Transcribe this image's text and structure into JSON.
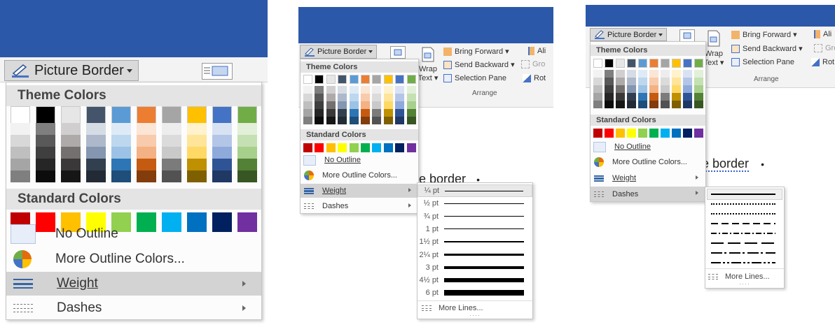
{
  "colors": {
    "titlebar": "#2b58a8",
    "theme_colors": [
      "#ffffff",
      "#000000",
      "#e7e6e6",
      "#44546a",
      "#5b9bd5",
      "#ed7d31",
      "#a5a5a5",
      "#ffc000",
      "#4472c4",
      "#70ad47"
    ],
    "theme_shades": [
      [
        "#f2f2f2",
        "#7f7f7f",
        "#d0cece",
        "#d6dce4",
        "#deebf6",
        "#fbe5d5",
        "#ededed",
        "#fff2cc",
        "#d9e2f3",
        "#e2efd9"
      ],
      [
        "#d8d8d8",
        "#595959",
        "#aeaaaa",
        "#adb9ca",
        "#bdd7ee",
        "#f7cbac",
        "#dbdbdb",
        "#fee599",
        "#b4c6e7",
        "#c5e0b3"
      ],
      [
        "#bfbfbf",
        "#3f3f3f",
        "#757070",
        "#8496b0",
        "#9cc3e5",
        "#f4b183",
        "#c9c9c9",
        "#ffd965",
        "#8eaadb",
        "#a8d08d"
      ],
      [
        "#a5a5a5",
        "#262626",
        "#3a3838",
        "#323f4f",
        "#2e75b5",
        "#c55a11",
        "#7b7b7b",
        "#bf9000",
        "#2f5496",
        "#538135"
      ],
      [
        "#7f7f7f",
        "#0c0c0c",
        "#171616",
        "#222a35",
        "#1e4e79",
        "#833c0b",
        "#525252",
        "#7f6000",
        "#1f3864",
        "#375623"
      ]
    ],
    "standard_colors": [
      "#c00000",
      "#ff0000",
      "#ffc000",
      "#ffff00",
      "#92d050",
      "#00b050",
      "#00b0f0",
      "#0070c0",
      "#002060",
      "#7030a0"
    ]
  },
  "ribbon": {
    "picture_border": "Picture Border",
    "wrap_text_line1": "Wrap",
    "wrap_text_line2": "Text",
    "bring_forward": "Bring Forward",
    "send_backward": "Send Backward",
    "selection_pane": "Selection Pane",
    "align": "Ali",
    "group": "Gro",
    "rotate": "Rot",
    "arrange": "Arrange"
  },
  "menu": {
    "theme_colors": "Theme Colors",
    "standard_colors": "Standard Colors",
    "no_outline": "No Outline",
    "more_outline_colors": "More Outline Colors...",
    "weight": "Weight",
    "dashes": "Dashes"
  },
  "weights": [
    "¼ pt",
    "½ pt",
    "¾ pt",
    "1 pt",
    "1½ pt",
    "2¼ pt",
    "3 pt",
    "4½ pt",
    "6 pt"
  ],
  "weight_thickness_pt": [
    0.25,
    0.5,
    0.75,
    1,
    1.5,
    2.25,
    3,
    4.5,
    6
  ],
  "more_lines": "More Lines...",
  "doc": {
    "text_partial": "e border",
    "bullet": "•"
  }
}
